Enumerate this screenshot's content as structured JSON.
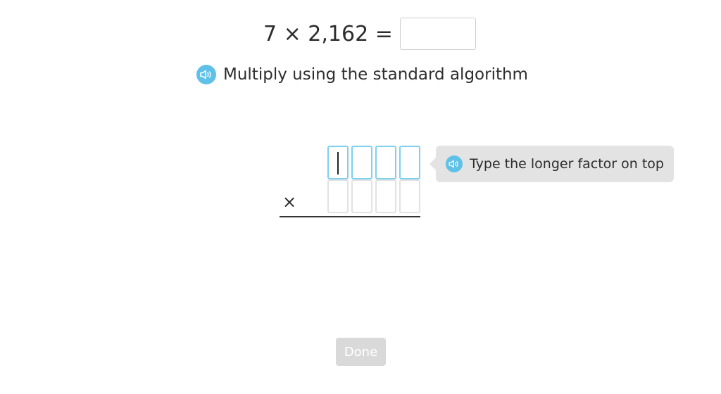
{
  "problem": {
    "expression": "7 × 2,162 =",
    "answer_value": ""
  },
  "instruction": {
    "text": "Multiply using the standard algorithm",
    "speaker_icon": "speaker-icon"
  },
  "algorithm": {
    "operator": "×",
    "top_cells": [
      "",
      "",
      "",
      ""
    ],
    "bottom_cells": [
      "",
      "",
      "",
      ""
    ]
  },
  "hint": {
    "text": "Type the longer factor on top",
    "speaker_icon": "speaker-icon"
  },
  "done_button": {
    "label": "Done",
    "enabled": false
  },
  "colors": {
    "accent": "#5fc1e8",
    "active_border": "#7fd0ef",
    "inactive_border": "#e2e2e2",
    "hint_bg": "#e3e3e3",
    "button_disabled_bg": "#d9d9d9"
  }
}
